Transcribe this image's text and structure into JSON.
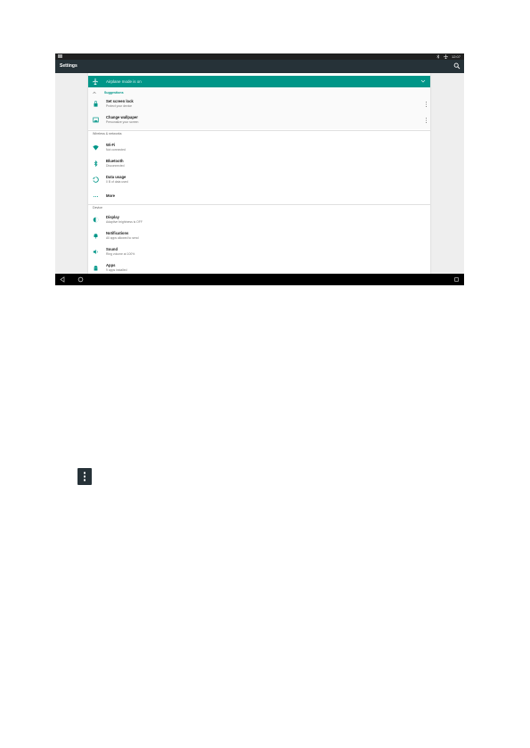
{
  "status_bar": {
    "time": "12:07"
  },
  "toolbar": {
    "title": "Settings"
  },
  "banner": {
    "text": "Airplane mode is on"
  },
  "suggestions": {
    "header": "Suggestions",
    "items": [
      {
        "title": "Set screen lock",
        "subtitle": "Protect your device"
      },
      {
        "title": "Change wallpaper",
        "subtitle": "Personalize your screen"
      }
    ]
  },
  "wireless": {
    "label": "Wireless & networks",
    "items": [
      {
        "title": "Wi-Fi",
        "subtitle": "Not connected"
      },
      {
        "title": "Bluetooth",
        "subtitle": "Disconnected"
      },
      {
        "title": "Data usage",
        "subtitle": "0 B of data used"
      },
      {
        "title": "More",
        "subtitle": ""
      }
    ]
  },
  "device": {
    "label": "Device",
    "items": [
      {
        "title": "Display",
        "subtitle": "Adaptive brightness is OFF"
      },
      {
        "title": "Notifications",
        "subtitle": "All apps allowed to send"
      },
      {
        "title": "Sound",
        "subtitle": "Ring volume at 100%"
      },
      {
        "title": "Apps",
        "subtitle": "9 apps installed"
      }
    ]
  },
  "colors": {
    "accent": "#009688",
    "toolbar": "#263238",
    "statusbar": "#202020",
    "navbar": "#000000"
  }
}
